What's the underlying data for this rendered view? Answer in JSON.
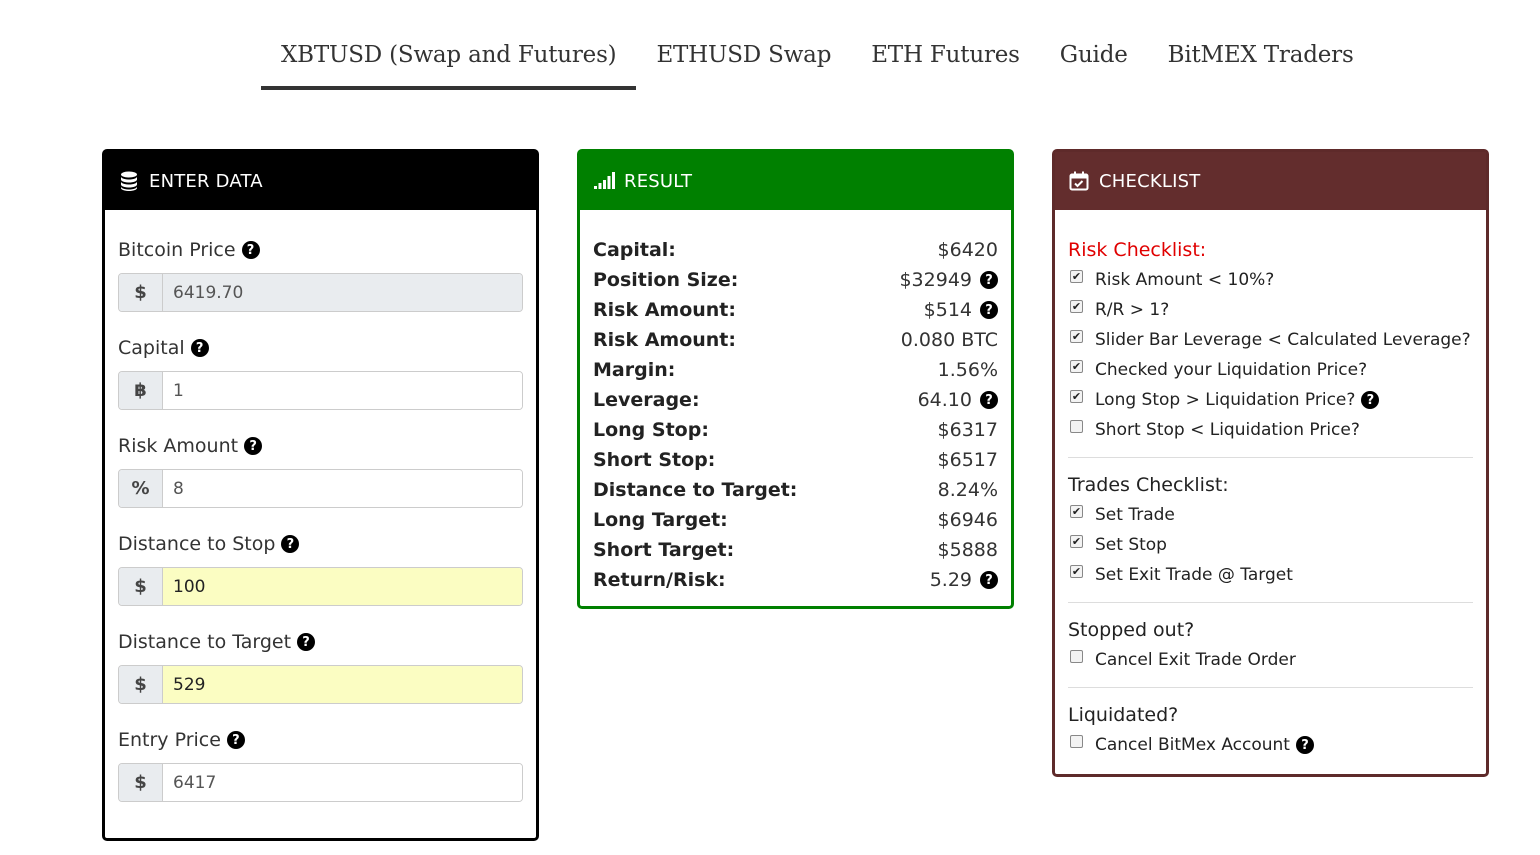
{
  "tabs": [
    {
      "label": "XBTUSD (Swap and Futures)",
      "active": true
    },
    {
      "label": "ETHUSD Swap"
    },
    {
      "label": "ETH Futures"
    },
    {
      "label": "Guide"
    },
    {
      "label": "BitMEX Traders"
    }
  ],
  "enter_data": {
    "title": "ENTER DATA",
    "icon": "database-icon",
    "fields": [
      {
        "label": "Bitcoin Price",
        "prefix": "$",
        "value": "6419.70"
      },
      {
        "label": "Capital",
        "prefix": "฿",
        "value": "1"
      },
      {
        "label": "Risk Amount",
        "prefix": "%",
        "value": "8"
      },
      {
        "label": "Distance to Stop",
        "prefix": "$",
        "value": "100"
      },
      {
        "label": "Distance to Target",
        "prefix": "$",
        "value": "529"
      },
      {
        "label": "Entry Price",
        "prefix": "$",
        "value": "6417"
      }
    ]
  },
  "result": {
    "title": "RESULT",
    "icon": "signal-bars-icon",
    "rows": [
      {
        "label": "Capital:",
        "value": "$6420"
      },
      {
        "label": "Position Size:",
        "value": "$32949"
      },
      {
        "label": "Risk Amount:",
        "value": "$514"
      },
      {
        "label": "Risk Amount:",
        "value": "0.080 BTC"
      },
      {
        "label": "Margin:",
        "value": "1.56%"
      },
      {
        "label": "Leverage:",
        "value": "64.10"
      },
      {
        "label": "Long Stop:",
        "value": "$6317"
      },
      {
        "label": "Short Stop:",
        "value": "$6517"
      },
      {
        "label": "Distance to Target:",
        "value": "8.24%"
      },
      {
        "label": "Long Target:",
        "value": "$6946"
      },
      {
        "label": "Short Target:",
        "value": "$5888"
      },
      {
        "label": "Return/Risk:",
        "value": "5.29"
      }
    ]
  },
  "checklist": {
    "title": "CHECKLIST",
    "icon": "calendar-check-icon",
    "risk": {
      "title": "Risk Checklist:",
      "items": [
        {
          "label": "Risk Amount < 10%?",
          "checked": true
        },
        {
          "label": "R/R > 1?",
          "checked": true
        },
        {
          "label": "Slider Bar Leverage < Calculated Leverage?",
          "checked": true
        },
        {
          "label": "Checked your Liquidation Price?",
          "checked": true
        },
        {
          "label": "Long Stop > Liquidation Price?",
          "checked": true
        },
        {
          "label": "Short Stop < Liquidation Price?",
          "checked": false
        }
      ]
    },
    "trades": {
      "title": "Trades Checklist:",
      "items": [
        {
          "label": "Set Trade",
          "checked": true
        },
        {
          "label": "Set Stop",
          "checked": true
        },
        {
          "label": "Set Exit Trade @ Target",
          "checked": true
        }
      ]
    },
    "stopped": {
      "title": "Stopped out?",
      "items": [
        {
          "label": "Cancel Exit Trade Order",
          "checked": false
        }
      ]
    },
    "liquidated": {
      "title": "Liquidated?",
      "items": [
        {
          "label": "Cancel BitMex Account",
          "checked": false
        }
      ]
    }
  },
  "help_icon": "?"
}
